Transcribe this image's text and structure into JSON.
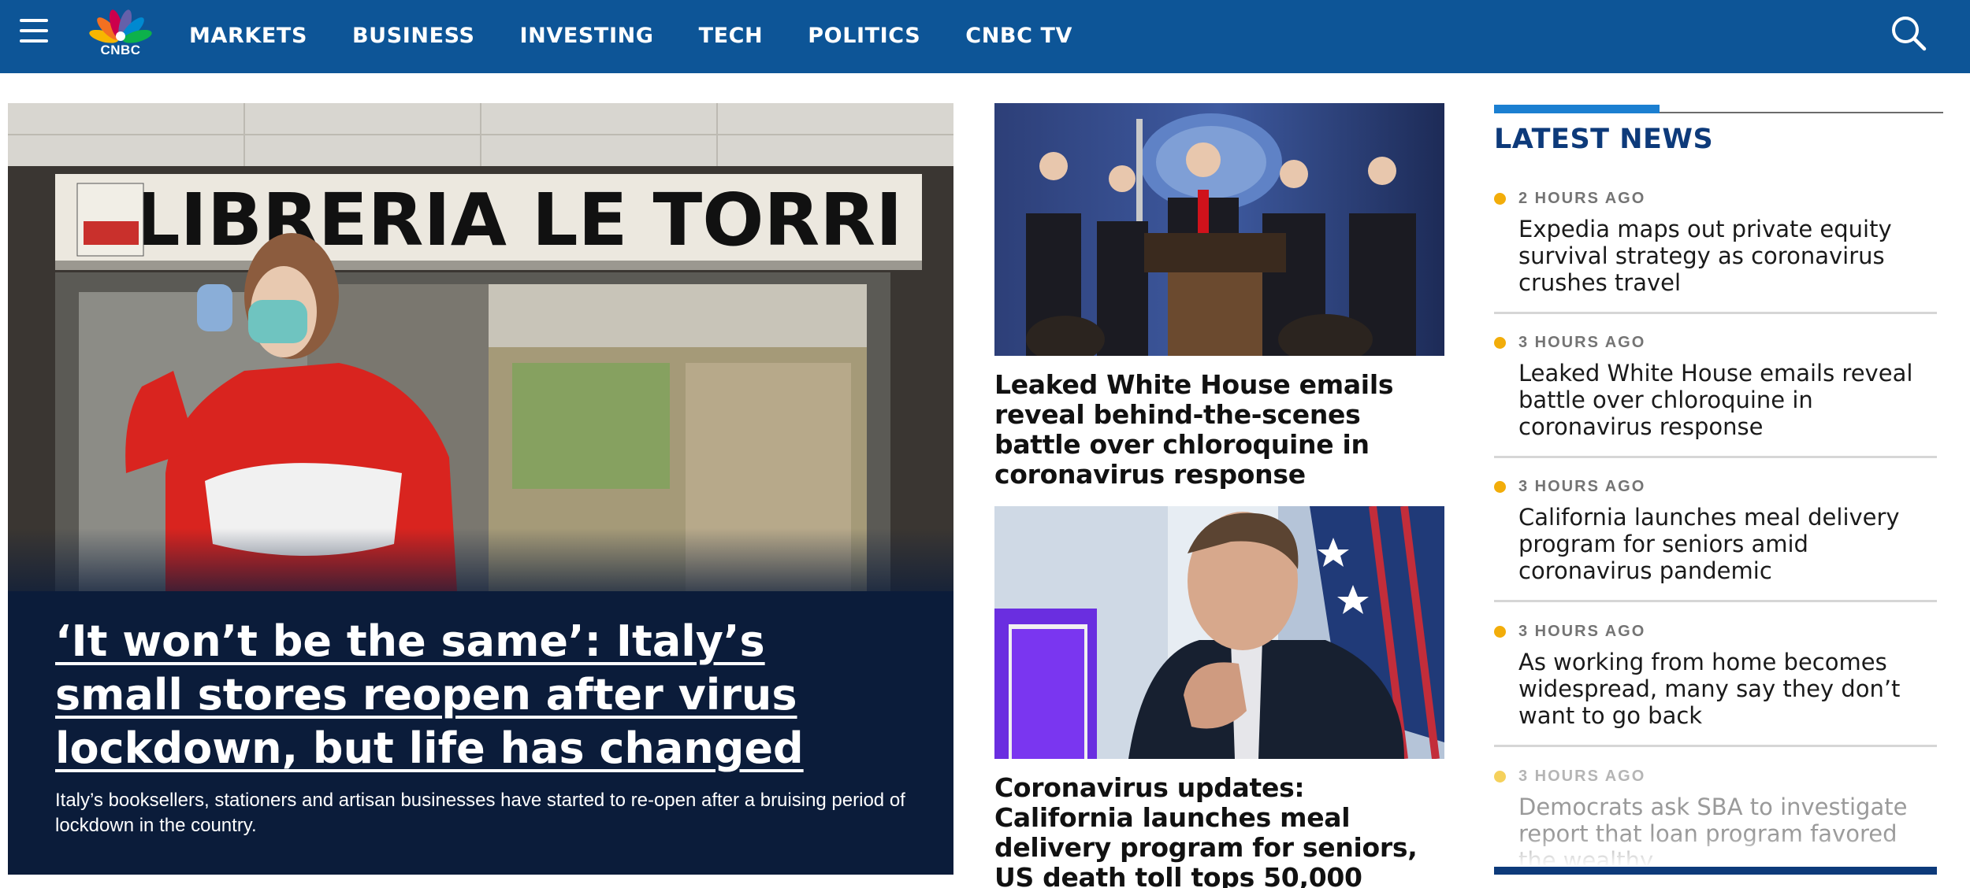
{
  "header": {
    "logo_text": "CNBC",
    "nav": [
      "MARKETS",
      "BUSINESS",
      "INVESTING",
      "TECH",
      "POLITICS",
      "CNBC TV"
    ],
    "brand_color": "#0d5597"
  },
  "hero": {
    "title": "‘It won’t be the same’: Italy’s small stores reopen after virus lockdown, but life has changed",
    "description": "Italy’s booksellers, stationers and artisan businesses have started to re-open after a bruising period of lockdown in the country.",
    "sign_text": "LIBRERIA LE TORRI"
  },
  "middle": {
    "cards": [
      {
        "title": "Leaked White House emails reveal behind-the-scenes battle over chloroquine in coronavirus response"
      },
      {
        "title": "Coronavirus updates: California launches meal delivery program for seniors, US death toll tops 50,000"
      }
    ]
  },
  "latest": {
    "heading": "LATEST NEWS",
    "items": [
      {
        "time": "2 HOURS AGO",
        "title": "Expedia maps out private equity survival strategy as coronavirus crushes travel"
      },
      {
        "time": "3 HOURS AGO",
        "title": "Leaked White House emails reveal battle over chloroquine in coronavirus response"
      },
      {
        "time": "3 HOURS AGO",
        "title": "California launches meal delivery program for seniors amid coronavirus pandemic"
      },
      {
        "time": "3 HOURS AGO",
        "title": "As working from home becomes widespread, many say they don’t want to go back"
      },
      {
        "time": "3 HOURS AGO",
        "title": "Democrats ask SBA to investigate report that loan program favored the wealthy"
      }
    ]
  }
}
